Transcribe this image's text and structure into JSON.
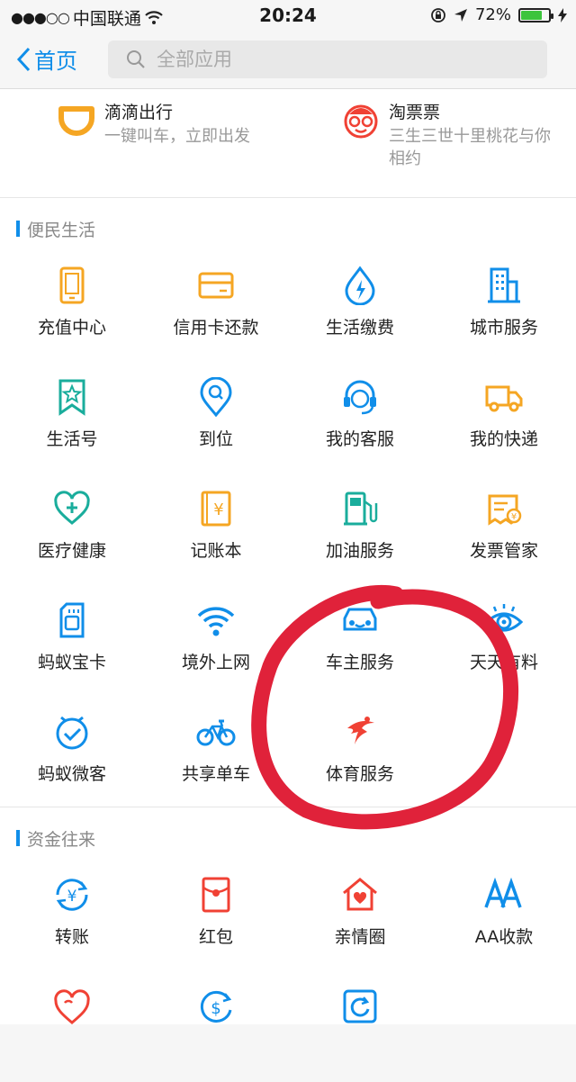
{
  "status_bar": {
    "carrier": "中国联通",
    "time": "20:24",
    "battery": "72%"
  },
  "nav": {
    "back_label": "首页",
    "search_placeholder": "全部应用"
  },
  "promo": [
    {
      "title": "滴滴出行",
      "subtitle": "一键叫车，立即出发",
      "icon": "didi-icon"
    },
    {
      "title": "淘票票",
      "subtitle": "三生三世十里桃花与你相约",
      "icon": "taopiaopiao-icon"
    }
  ],
  "sections": [
    {
      "title": "便民生活",
      "items": [
        {
          "label": "充值中心",
          "icon": "phone-icon"
        },
        {
          "label": "信用卡还款",
          "icon": "credit-card-icon"
        },
        {
          "label": "生活缴费",
          "icon": "water-drop-icon"
        },
        {
          "label": "城市服务",
          "icon": "building-icon"
        },
        {
          "label": "生活号",
          "icon": "bookmark-star-icon"
        },
        {
          "label": "到位",
          "icon": "location-search-icon"
        },
        {
          "label": "我的客服",
          "icon": "headset-icon"
        },
        {
          "label": "我的快递",
          "icon": "truck-icon"
        },
        {
          "label": "医疗健康",
          "icon": "stethoscope-icon"
        },
        {
          "label": "记账本",
          "icon": "ledger-icon"
        },
        {
          "label": "加油服务",
          "icon": "fuel-pump-icon"
        },
        {
          "label": "发票管家",
          "icon": "invoice-icon"
        },
        {
          "label": "蚂蚁宝卡",
          "icon": "sim-card-icon"
        },
        {
          "label": "境外上网",
          "icon": "wifi-icon"
        },
        {
          "label": "车主服务",
          "icon": "car-icon"
        },
        {
          "label": "天天有料",
          "icon": "eye-icon"
        },
        {
          "label": "蚂蚁微客",
          "icon": "shield-check-icon"
        },
        {
          "label": "共享单车",
          "icon": "bicycle-icon"
        },
        {
          "label": "体育服务",
          "icon": "sports-icon"
        }
      ]
    },
    {
      "title": "资金往来",
      "items": [
        {
          "label": "转账",
          "icon": "transfer-icon"
        },
        {
          "label": "红包",
          "icon": "red-envelope-icon"
        },
        {
          "label": "亲情圈",
          "icon": "home-heart-icon"
        },
        {
          "label": "AA收款",
          "icon": "aa-icon"
        },
        {
          "label": "",
          "icon": "heart-icon"
        },
        {
          "label": "",
          "icon": "dollar-arrow-icon"
        },
        {
          "label": "",
          "icon": "refresh-icon"
        }
      ]
    }
  ],
  "colors": {
    "accent": "#108ee9",
    "orange": "#f5a623",
    "red": "#f04134",
    "annotation": "#e0223a"
  }
}
